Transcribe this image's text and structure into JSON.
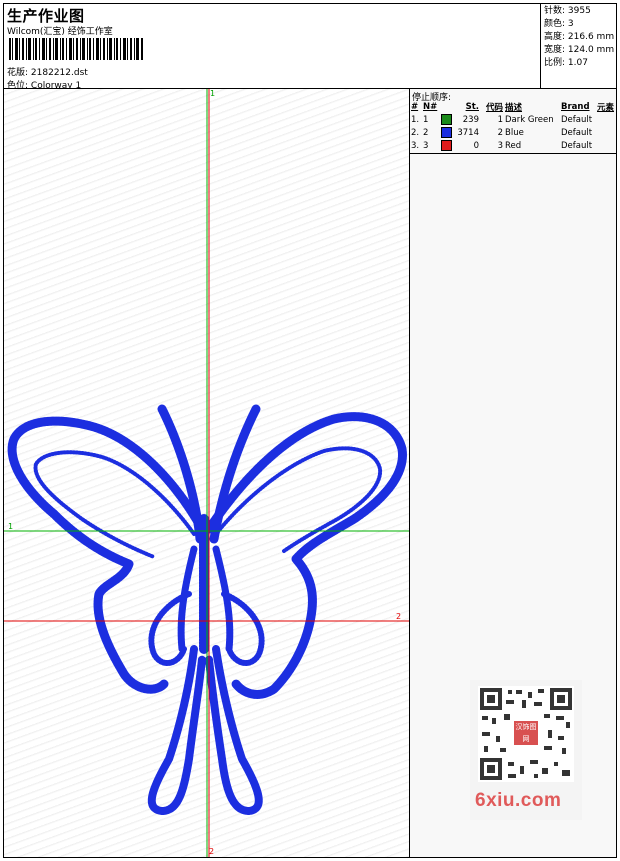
{
  "header": {
    "title": "生产作业图",
    "company": "Wilcom(汇宝) 经饰工作室",
    "file_label": "花版:",
    "file_name": "2182212.dst",
    "colorway_label": "色位:",
    "colorway": "Colorway 1"
  },
  "stats": {
    "stitches_label": "针数:",
    "stitches": "3955",
    "colors_label": "颜色:",
    "colors": "3",
    "height_label": "高度:",
    "height": "216.6 mm",
    "width_label": "宽度:",
    "width": "124.0 mm",
    "scale_label": "比例:",
    "scale": "1.07"
  },
  "stop_sequence": {
    "label": "停止顺序:",
    "headers": [
      "#",
      "N#",
      "",
      "St.",
      "代码",
      "描述",
      "Brand",
      "元素"
    ],
    "rows": [
      {
        "idx": "1.",
        "n": "1",
        "color": "#1a8a1a",
        "st": "239",
        "code": "1",
        "desc": "Dark Green",
        "brand": "Default"
      },
      {
        "idx": "2.",
        "n": "2",
        "color": "#1c2ee0",
        "st": "3714",
        "code": "2",
        "desc": "Blue",
        "brand": "Default"
      },
      {
        "idx": "3.",
        "n": "3",
        "color": "#e01c1c",
        "st": "0",
        "code": "3",
        "desc": "Red",
        "brand": "Default"
      }
    ]
  },
  "axis_markers": {
    "top": "1",
    "bottom": "2",
    "left": "1",
    "right": "2"
  },
  "watermark": {
    "seal": "汉饰图网",
    "site": "6xiu.com"
  },
  "colors": {
    "thread": "#1c2ee0",
    "green_axis": "#00b000",
    "red_axis": "#e00000"
  }
}
